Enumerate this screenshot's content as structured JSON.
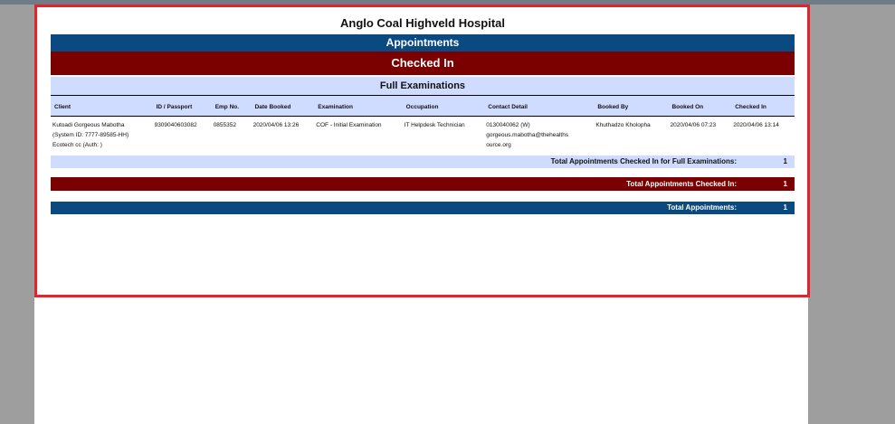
{
  "report": {
    "hospital": "Anglo Coal Highveld Hospital",
    "section": "Appointments",
    "status": "Checked In",
    "category": "Full Examinations"
  },
  "table": {
    "headers": [
      "Client",
      "ID / Passport",
      "Emp No.",
      "Date Booked",
      "Examination",
      "Occupation",
      "Contact Detail",
      "Booked By",
      "Booked On",
      "Checked In"
    ],
    "rows": [
      {
        "client_line1": "Kutoadi Gorgeous Mabotha",
        "client_line2": "(System ID: 7777-89585-HH)",
        "client_line3": "Ecotech cc (Auth: )",
        "id_passport": "9309040603082",
        "emp_no": "0855352",
        "date_booked": "2020/04/06 13:26",
        "examination": "COF - Initial Examination",
        "occupation": "IT Helpdesk Technician",
        "contact_line1": "0130040062 (W)",
        "contact_line2": "gorgeous.mabotha@thehealths",
        "contact_line3": "ource.org",
        "booked_by": "Khuthadzo Kholopha",
        "booked_on": "2020/04/06 07:23",
        "checked_in": "2020/04/06 13:14"
      }
    ]
  },
  "totals": {
    "category_label": "Total Appointments Checked In for Full Examinations:",
    "category_value": "1",
    "checked_in_label": "Total Appointments Checked In:",
    "checked_in_value": "1",
    "all_label": "Total Appointments:",
    "all_value": "1"
  },
  "colors": {
    "blue_band": "#0b4a80",
    "red_band": "#7b0000",
    "light_band": "#cfdcff",
    "highlight_border": "#e3242b"
  }
}
